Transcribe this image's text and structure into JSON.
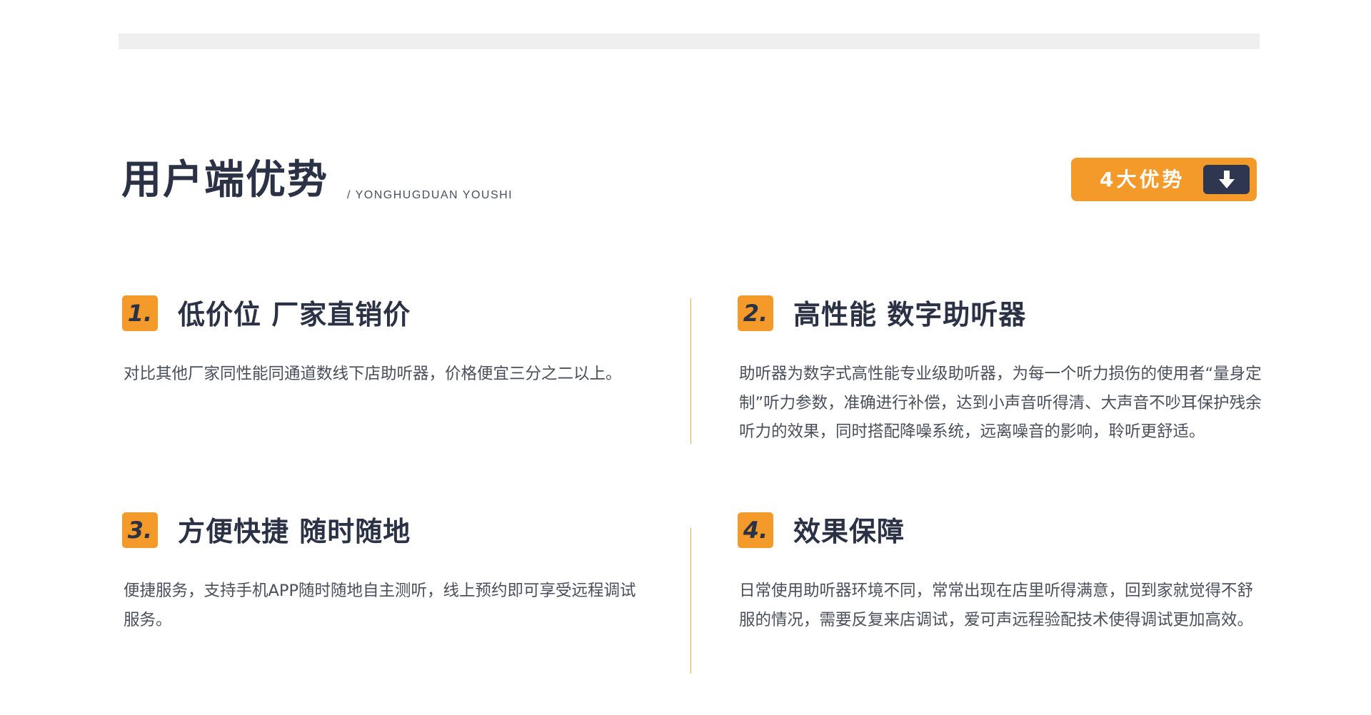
{
  "header": {
    "title": "用户端优势",
    "subtitle": "/ YONGHUGDUAN YOUSHI",
    "badge_label": "4大优势",
    "badge_icon": "arrow-down-icon"
  },
  "colors": {
    "accent": "#f39a2a",
    "dark": "#2b3246",
    "text": "#4a4f5c",
    "divider": "#f3a644",
    "top_bar": "#efefef"
  },
  "features": [
    {
      "number": "1.",
      "title": "低价位 厂家直销价",
      "description": "对比其他厂家同性能同通道数线下店助听器，价格便宜三分之二以上。"
    },
    {
      "number": "2.",
      "title": "高性能 数字助听器",
      "description": "助听器为数字式高性能专业级助听器，为每一个听力损伤的使用者“量身定制”听力参数，准确进行补偿，达到小声音听得清、大声音不吵耳保护残余听力的效果，同时搭配降噪系统，远离噪音的影响，聆听更舒适。"
    },
    {
      "number": "3.",
      "title": "方便快捷 随时随地",
      "description": "便捷服务，支持手机APP随时随地自主测听，线上预约即可享受远程调试服务。"
    },
    {
      "number": "4.",
      "title": "效果保障",
      "description": "日常使用助听器环境不同，常常出现在店里听得满意，回到家就觉得不舒服的情况，需要反复来店调试，爱可声远程验配技术使得调试更加高效。"
    }
  ]
}
